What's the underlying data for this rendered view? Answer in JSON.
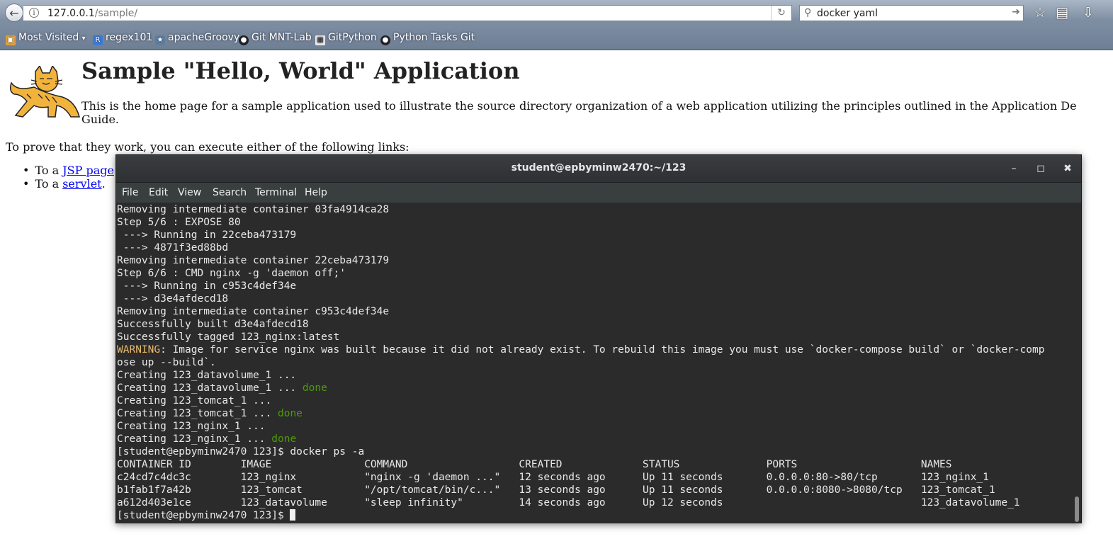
{
  "browser": {
    "url_host": "127.0.0.1",
    "url_path": "/sample/",
    "search_value": "docker yaml",
    "bookmarks": [
      {
        "label": "Most Visited",
        "icon": "folder-icon"
      },
      {
        "label": "regex101",
        "icon": "regex101-icon"
      },
      {
        "label": "apacheGroovy",
        "icon": "groovy-icon"
      },
      {
        "label": "Git MNT-Lab",
        "icon": "github-icon"
      },
      {
        "label": "GitPython",
        "icon": "gitpython-icon"
      },
      {
        "label": "Python Tasks Git",
        "icon": "github-icon"
      }
    ]
  },
  "page": {
    "title": "Sample \"Hello, World\" Application",
    "intro": "This is the home page for a sample application used to illustrate the source directory organization of a web application utilizing the principles outlined in the Application De",
    "intro_cont": "Guide.",
    "prove": "To prove that they work, you can execute either of the following links:",
    "links": [
      {
        "prefix": "To a ",
        "link": "JSP page"
      },
      {
        "prefix": "To a ",
        "link": "servlet",
        "suffix": "."
      }
    ]
  },
  "terminal": {
    "title": "student@epbyminw2470:~/123",
    "menu": [
      "File",
      "Edit",
      "View",
      "Search",
      "Terminal",
      "Help"
    ],
    "lines": [
      "Removing intermediate container 03fa4914ca28",
      "Step 5/6 : EXPOSE 80",
      " ---> Running in 22ceba473179",
      " ---> 4871f3ed88bd",
      "Removing intermediate container 22ceba473179",
      "Step 6/6 : CMD nginx -g 'daemon off;'",
      " ---> Running in c953c4def34e",
      " ---> d3e4afdecd18",
      "Removing intermediate container c953c4def34e",
      "Successfully built d3e4afdecd18",
      "Successfully tagged 123_nginx:latest"
    ],
    "warning_label": "WARNING",
    "warning_text": ": Image for service nginx was built because it did not already exist. To rebuild this image you must use `docker-compose build` or `docker-comp",
    "warning_cont": "ose up --build`.",
    "creating": [
      {
        "text": "Creating 123_datavolume_1 ... ",
        "status": ""
      },
      {
        "text": "Creating 123_datavolume_1 ... ",
        "status": "done"
      },
      {
        "text": "Creating 123_tomcat_1 ... ",
        "status": ""
      },
      {
        "text": "Creating 123_tomcat_1 ... ",
        "status": "done"
      },
      {
        "text": "Creating 123_nginx_1 ... ",
        "status": ""
      },
      {
        "text": "Creating 123_nginx_1 ... ",
        "status": "done"
      }
    ],
    "prompt_cmd": "[student@epbyminw2470 123]$ docker ps -a",
    "table_header": "CONTAINER ID        IMAGE               COMMAND                  CREATED             STATUS              PORTS                    NAMES",
    "table_rows": [
      "c24cd7c4dc3c        123_nginx           \"nginx -g 'daemon ...\"   12 seconds ago      Up 11 seconds       0.0.0.0:80->80/tcp       123_nginx_1",
      "b1fab1f7a42b        123_tomcat          \"/opt/tomcat/bin/c...\"   13 seconds ago      Up 11 seconds       0.0.0.0:8080->8080/tcp   123_tomcat_1",
      "a612d403e1ce        123_datavolume      \"sleep infinity\"         14 seconds ago      Up 12 seconds                                123_datavolume_1"
    ],
    "final_prompt": "[student@epbyminw2470 123]$ "
  }
}
